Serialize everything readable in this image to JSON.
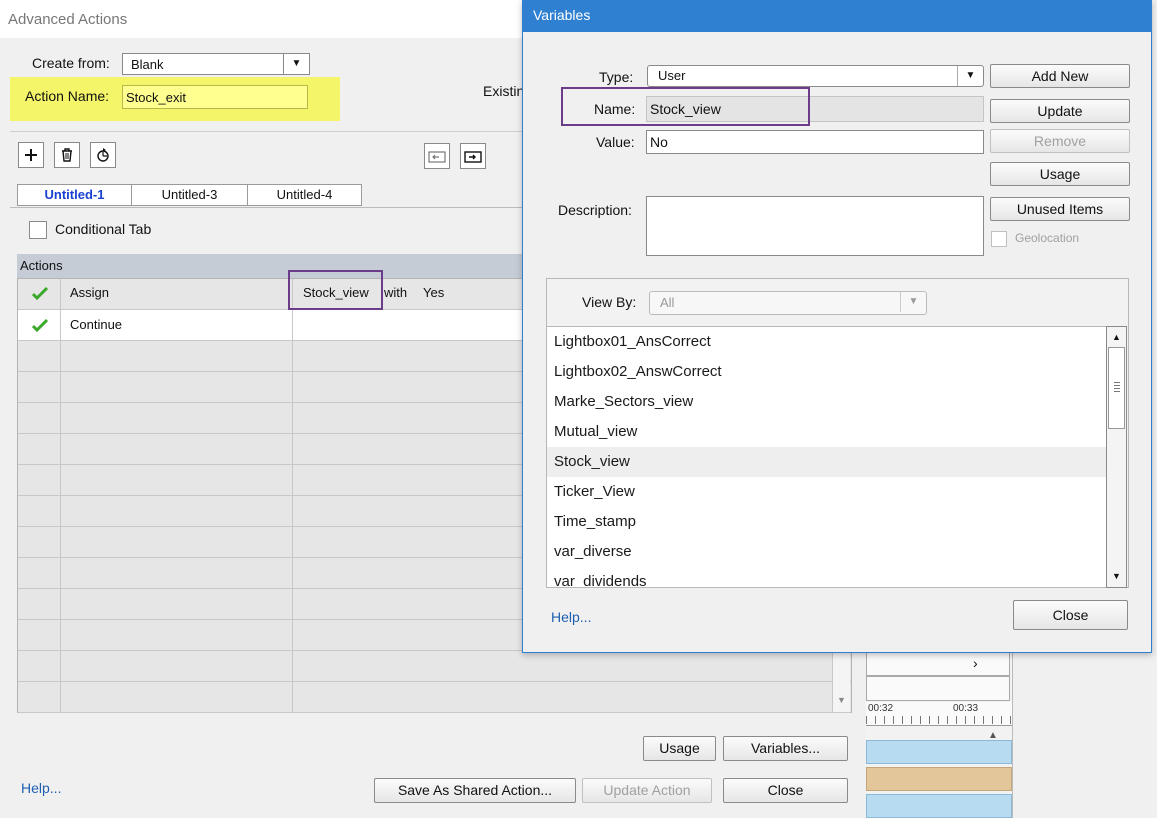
{
  "advanced_actions": {
    "window_title": "Advanced Actions",
    "create_from_label": "Create from:",
    "create_from_value": "Blank",
    "action_name_label": "Action Name:",
    "action_name_value": "Stock_exit",
    "existing_label": "Existin",
    "tabs": [
      "Untitled-1",
      "Untitled-3",
      "Untitled-4"
    ],
    "conditional_tab_label": "Conditional Tab",
    "actions_header": "Actions",
    "rows": [
      {
        "action": "Assign",
        "target": "Stock_view",
        "with": "with",
        "value": "Yes"
      },
      {
        "action": "Continue",
        "target": "",
        "with": "",
        "value": ""
      }
    ],
    "usage_button": "Usage",
    "variables_button": "Variables...",
    "help_link": "Help...",
    "save_shared_button": "Save As Shared Action...",
    "update_action_button": "Update Action",
    "close_button": "Close"
  },
  "variables_dialog": {
    "title": "Variables",
    "type_label": "Type:",
    "type_value": "User",
    "name_label": "Name:",
    "name_value": "Stock_view",
    "value_label": "Value:",
    "value_value": "No",
    "description_label": "Description:",
    "add_new_button": "Add New",
    "update_button": "Update",
    "remove_button": "Remove",
    "usage_button": "Usage",
    "unused_items_button": "Unused Items",
    "geolocation_label": "Geolocation",
    "view_by_label": "View By:",
    "view_by_value": "All",
    "variables": [
      "Lightbox01_AnsCorrect",
      "Lightbox02_AnswCorrect",
      "Marke_Sectors_view",
      "Mutual_view",
      "Stock_view",
      "Ticker_View",
      "Time_stamp",
      "var_diverse",
      "var_dividends"
    ],
    "selected_variable": "Stock_view",
    "help_link": "Help...",
    "close_button": "Close"
  },
  "timeline": {
    "marks": [
      "00:32",
      "00:33"
    ]
  },
  "colors": {
    "highlight_yellow": "#f5f56a",
    "callout_purple": "#6a3c8a",
    "dialog_titlebar": "#2f80d0"
  }
}
